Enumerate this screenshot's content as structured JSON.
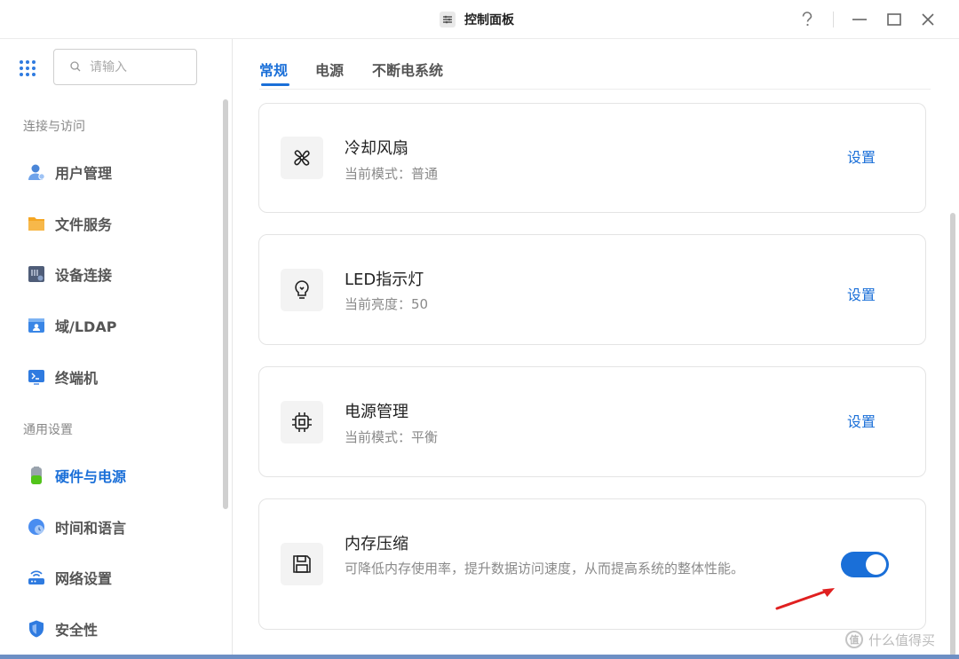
{
  "window": {
    "title": "控制面板",
    "help_icon": "question-icon",
    "minimize_icon": "minimize-icon",
    "maximize_icon": "maximize-icon",
    "close_icon": "close-icon"
  },
  "search": {
    "placeholder": "请输入",
    "value": ""
  },
  "sidebar": {
    "sections": [
      {
        "label": "连接与访问",
        "items": [
          {
            "label": "用户管理",
            "icon": "user-management-icon",
            "active": false
          },
          {
            "label": "文件服务",
            "icon": "folder-icon",
            "active": false
          },
          {
            "label": "设备连接",
            "icon": "device-icon",
            "active": false
          },
          {
            "label": "域/LDAP",
            "icon": "domain-icon",
            "active": false
          },
          {
            "label": "终端机",
            "icon": "terminal-icon",
            "active": false
          }
        ]
      },
      {
        "label": "通用设置",
        "items": [
          {
            "label": "硬件与电源",
            "icon": "battery-icon",
            "active": true
          },
          {
            "label": "时间和语言",
            "icon": "globe-clock-icon",
            "active": false
          },
          {
            "label": "网络设置",
            "icon": "router-icon",
            "active": false
          },
          {
            "label": "安全性",
            "icon": "shield-icon",
            "active": false
          }
        ]
      }
    ]
  },
  "tabs": [
    {
      "label": "常规",
      "active": true
    },
    {
      "label": "电源",
      "active": false
    },
    {
      "label": "不断电系统",
      "active": false
    }
  ],
  "cards": [
    {
      "title": "冷却风扇",
      "subtitle": "当前模式：普通",
      "action": "设置",
      "icon": "fan-icon"
    },
    {
      "title": "LED指示灯",
      "subtitle": "当前亮度：50",
      "action": "设置",
      "icon": "bulb-icon"
    },
    {
      "title": "电源管理",
      "subtitle": "当前模式：平衡",
      "action": "设置",
      "icon": "chip-icon"
    },
    {
      "title": "内存压缩",
      "subtitle": "可降低内存使用率，提升数据访问速度，从而提高系统的整体性能。",
      "toggle_on": true,
      "icon": "save-icon"
    }
  ],
  "watermark": "什么值得买",
  "colors": {
    "accent": "#1a6fd8",
    "annotation_arrow": "#e02020"
  }
}
